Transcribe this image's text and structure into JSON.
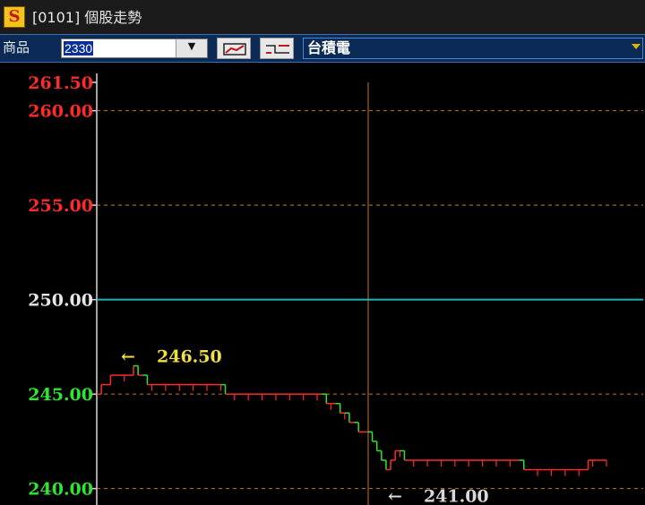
{
  "window": {
    "title": "[0101] 個股走勢",
    "icon": "dollar-icon",
    "icon_glyph": "S"
  },
  "toolbar": {
    "product_label": "商品",
    "symbol_value": "2330",
    "dropdown_glyph": "▼",
    "stock_name": "台積電",
    "buttons": [
      {
        "icon": "line-chart-icon"
      },
      {
        "icon": "compare-icon"
      }
    ]
  },
  "colors": {
    "up": "#ff2a2a",
    "down": "#2ee62e",
    "flat": "#e6e6e6",
    "ref": "#1fb5b5",
    "grid": "#c07a2a",
    "max": "#f0e040",
    "min": "#d9d9d9"
  },
  "chart_data": {
    "type": "line",
    "title": "",
    "xlabel": "",
    "ylabel": "",
    "ylim": [
      239.7,
      261.5
    ],
    "reference_price": 250.0,
    "y_ticks": [
      {
        "value": 261.5,
        "label": "261.50",
        "color": "up"
      },
      {
        "value": 260.0,
        "label": "260.00",
        "color": "up"
      },
      {
        "value": 255.0,
        "label": "255.00",
        "color": "up"
      },
      {
        "value": 250.0,
        "label": "250.00",
        "color": "flat"
      },
      {
        "value": 245.0,
        "label": "245.00",
        "color": "down"
      },
      {
        "value": 240.0,
        "label": "240.00",
        "color": "down"
      }
    ],
    "annotations": [
      {
        "label": "246.50",
        "value": 246.5,
        "color": "max",
        "arrow": "←"
      },
      {
        "label": "241.00",
        "value": 241.0,
        "color": "min",
        "arrow": "←"
      }
    ],
    "series": [
      {
        "values": [
          245.0,
          245.5,
          245.5,
          246.0,
          246.0,
          246.0,
          246.0,
          246.0,
          246.5,
          246.0,
          246.0,
          245.5,
          245.5,
          245.5,
          245.5,
          245.5,
          245.5,
          245.5,
          245.5,
          245.5,
          245.5,
          245.5,
          245.5,
          245.5,
          245.5,
          245.5,
          245.5,
          245.5,
          245.0,
          245.0,
          245.0,
          245.0,
          245.0,
          245.0,
          245.0,
          245.0,
          245.0,
          245.0,
          245.0,
          245.0,
          245.0,
          245.0,
          245.0,
          245.0,
          245.0,
          245.0,
          245.0,
          245.0,
          245.0,
          245.0,
          244.5,
          244.5,
          244.5,
          244.0,
          244.0,
          243.5,
          243.5,
          243.0,
          243.0,
          243.0,
          242.5,
          242.0,
          241.5,
          241.0,
          241.5,
          242.0,
          242.0,
          241.5,
          241.5,
          241.5,
          241.5,
          241.5,
          241.5,
          241.5,
          241.5,
          241.5,
          241.5,
          241.5,
          241.5,
          241.5,
          241.5,
          241.5,
          241.5,
          241.5,
          241.5,
          241.5,
          241.5,
          241.5,
          241.5,
          241.5,
          241.5,
          241.5,
          241.5,
          241.0,
          241.0,
          241.0,
          241.0,
          241.0,
          241.0,
          241.0,
          241.0,
          241.0,
          241.0,
          241.0,
          241.0,
          241.0,
          241.0,
          241.5,
          241.5,
          241.5,
          241.5,
          241.5
        ]
      }
    ]
  }
}
